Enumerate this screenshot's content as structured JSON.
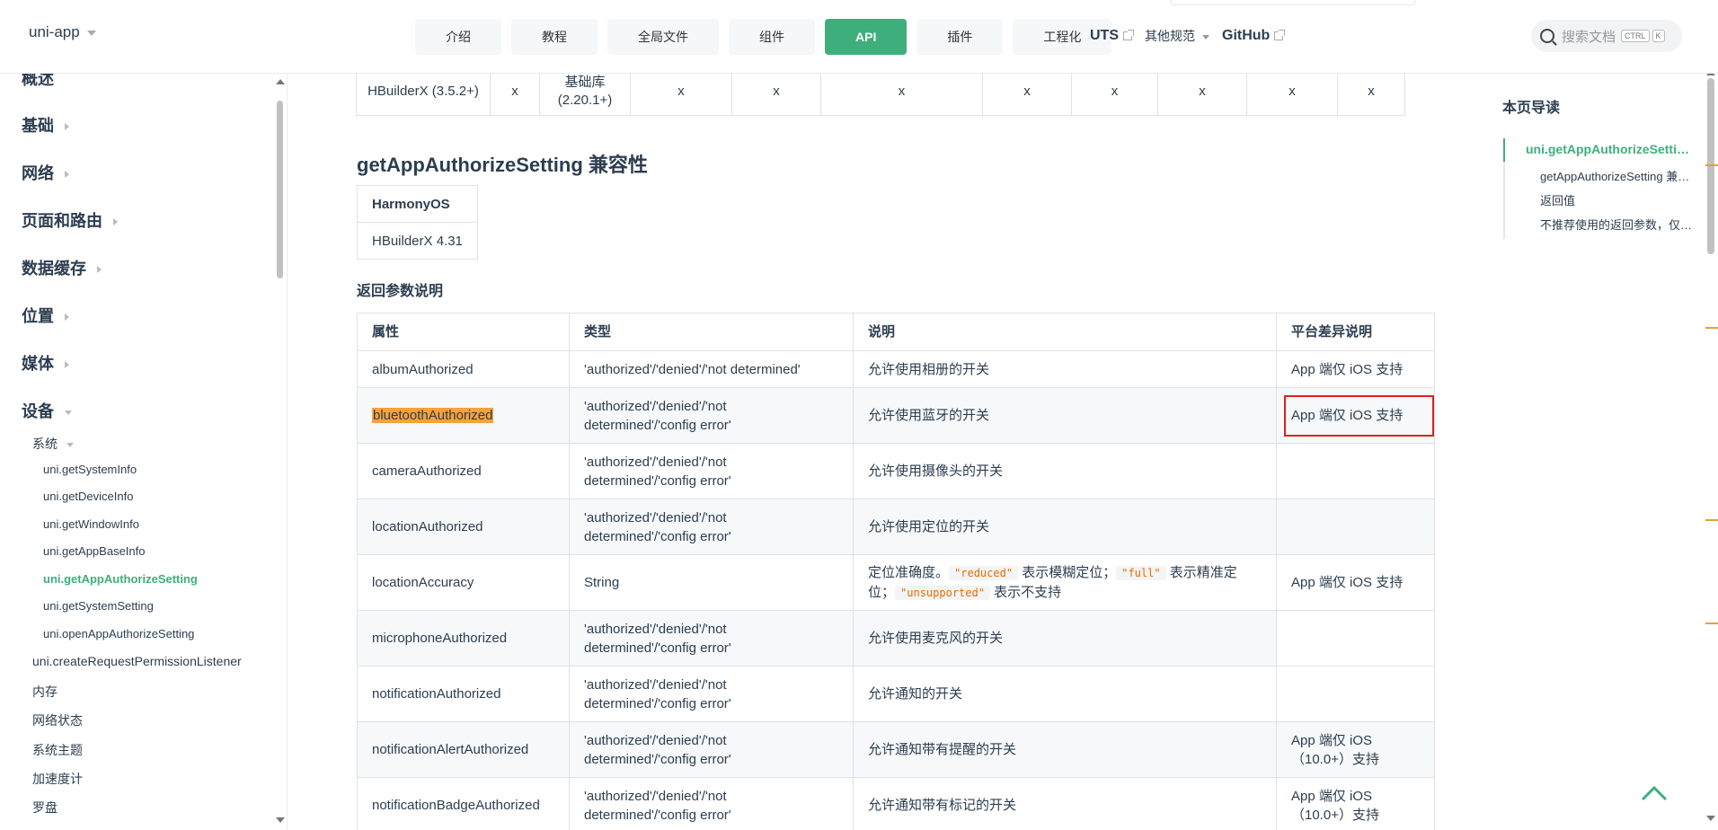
{
  "navbar": {
    "brand": "uni-app",
    "pills": [
      "介绍",
      "教程",
      "全局文件",
      "组件",
      "API",
      "插件",
      "工程化"
    ],
    "active_pill": "API",
    "links": {
      "uts": "UTS",
      "other": "其他规范",
      "github": "GitHub"
    },
    "search_placeholder": "搜索文档",
    "kbd_ctrl": "CTRL",
    "kbd_k": "K"
  },
  "sidebar": {
    "groups": [
      "概述",
      "基础",
      "网络",
      "页面和路由",
      "数据缓存",
      "位置",
      "媒体",
      "设备"
    ],
    "device_sub": "系统",
    "system_leaves": [
      "uni.getSystemInfo",
      "uni.getDeviceInfo",
      "uni.getWindowInfo",
      "uni.getAppBaseInfo",
      "uni.getAppAuthorizeSetting",
      "uni.getSystemSetting",
      "uni.openAppAuthorizeSetting"
    ],
    "active_leaf": "uni.getAppAuthorizeSetting",
    "device_items": [
      "uni.createRequestPermissionListener",
      "内存",
      "网络状态",
      "系统主题",
      "加速度计",
      "罗盘"
    ]
  },
  "top_table": {
    "cells": [
      "HBuilderX (3.5.2+)",
      "x",
      "基础库 (2.20.1+)",
      "x",
      "x",
      "x",
      "x",
      "x",
      "x",
      "x",
      "x"
    ]
  },
  "compat": {
    "title": "getAppAuthorizeSetting 兼容性",
    "header": "HarmonyOS",
    "value": "HBuilderX 4.31"
  },
  "params": {
    "title": "返回参数说明",
    "headers": [
      "属性",
      "类型",
      "说明",
      "平台差异说明"
    ],
    "rows": [
      {
        "prop": "albumAuthorized",
        "type": "'authorized'/'denied'/'not determined'",
        "desc": "允许使用相册的开关",
        "platform": "App 端仅 iOS 支持"
      },
      {
        "prop": "bluetoothAuthorized",
        "type": "'authorized'/'denied'/'not determined'/'config error'",
        "desc": "允许使用蓝牙的开关",
        "platform": "App 端仅 iOS 支持"
      },
      {
        "prop": "cameraAuthorized",
        "type": "'authorized'/'denied'/'not determined'/'config error'",
        "desc": "允许使用摄像头的开关",
        "platform": ""
      },
      {
        "prop": "locationAuthorized",
        "type": "'authorized'/'denied'/'not determined'/'config error'",
        "desc": "允许使用定位的开关",
        "platform": ""
      },
      {
        "prop": "locationAccuracy",
        "type": "String",
        "desc_prefix": "定位准确度。",
        "code1": "\"reduced\"",
        "desc_mid1": " 表示模糊定位；",
        "code2": "\"full\"",
        "desc_mid2": " 表示精准定位；",
        "code3": "\"unsupported\"",
        "desc_suffix": " 表示不支持",
        "platform": "App 端仅 iOS 支持"
      },
      {
        "prop": "microphoneAuthorized",
        "type": "'authorized'/'denied'/'not determined'/'config error'",
        "desc": "允许使用麦克风的开关",
        "platform": ""
      },
      {
        "prop": "notificationAuthorized",
        "type": "'authorized'/'denied'/'not determined'/'config error'",
        "desc": "允许通知的开关",
        "platform": ""
      },
      {
        "prop": "notificationAlertAuthorized",
        "type": "'authorized'/'denied'/'not determined'/'config error'",
        "desc": "允许通知带有提醒的开关",
        "platform": "App 端仅 iOS（10.0+）支持"
      },
      {
        "prop": "notificationBadgeAuthorized",
        "type": "'authorized'/'denied'/'not determined'/'config error'",
        "desc": "允许通知带有标记的开关",
        "platform": "App 端仅 iOS（10.0+）支持"
      }
    ]
  },
  "toc": {
    "title": "本页导读",
    "items": [
      "uni.getAppAuthorizeSetting()",
      "getAppAuthorizeSetting 兼容性",
      "返回值",
      "不推荐使用的返回参数，仅为兼容"
    ]
  },
  "colors": {
    "accent": "#3eaf7c",
    "highlight": "#f9a13a",
    "selection_box": "#e02020"
  }
}
